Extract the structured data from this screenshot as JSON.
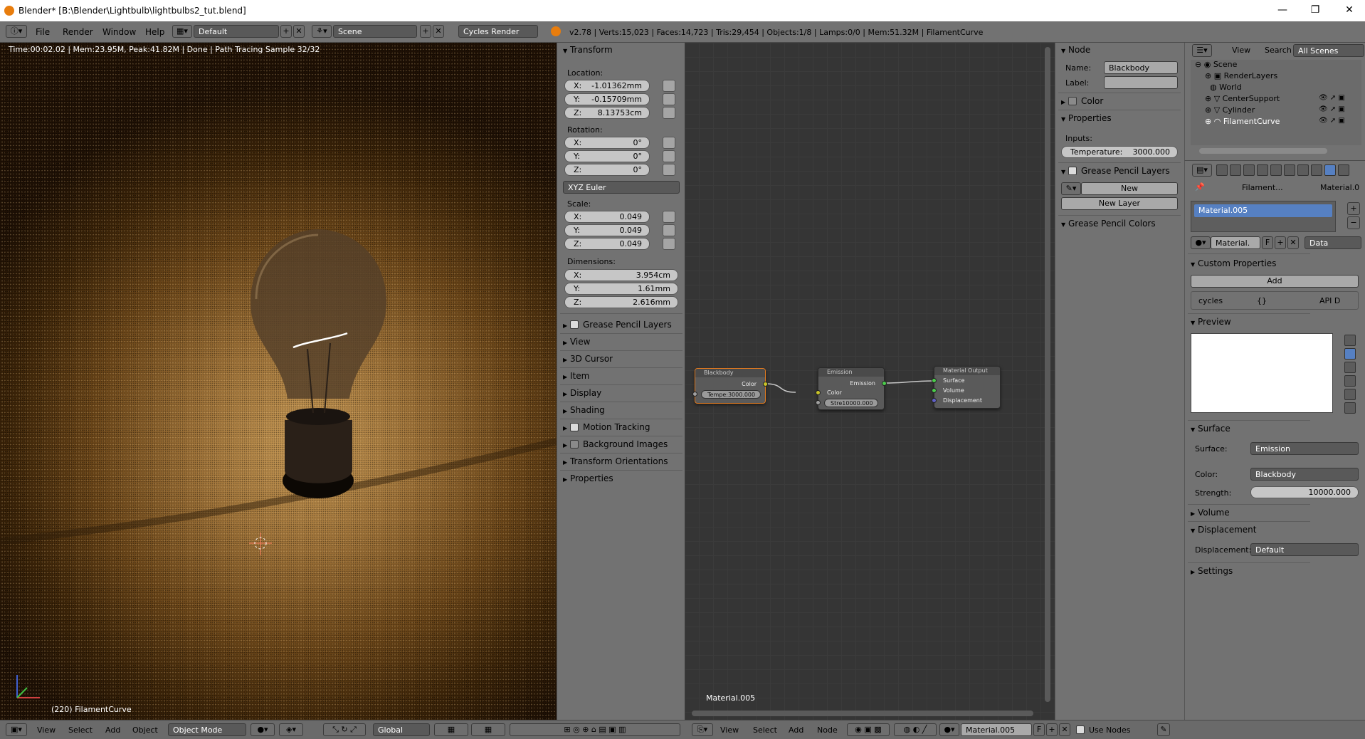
{
  "window": {
    "title": "Blender* [B:\\Blender\\Lightbulb\\lightbulbs2_tut.blend]",
    "min": "—",
    "max": "❐",
    "close": "✕"
  },
  "infobar": {
    "menus": [
      "File",
      "Render",
      "Window",
      "Help"
    ],
    "layout": "Default",
    "scene": "Scene",
    "engine": "Cycles Render",
    "stats": "v2.78 | Verts:15,023 | Faces:14,723 | Tris:29,454 | Objects:1/8 | Lamps:0/0 | Mem:51.32M | FilamentCurve"
  },
  "viewport": {
    "render_status": "Time:00:02.02 | Mem:23.95M, Peak:41.82M | Done | Path Tracing Sample 32/32",
    "object_label": "(220) FilamentCurve",
    "header": {
      "menus": [
        "View",
        "Select",
        "Add",
        "Object"
      ],
      "mode": "Object Mode",
      "orientation": "Global"
    }
  },
  "npanel": {
    "transform_title": "Transform",
    "location_label": "Location:",
    "location": [
      {
        "k": "X:",
        "v": "-1.01362mm"
      },
      {
        "k": "Y:",
        "v": "-0.15709mm"
      },
      {
        "k": "Z:",
        "v": "8.13753cm"
      }
    ],
    "rotation_label": "Rotation:",
    "rotation": [
      {
        "k": "X:",
        "v": "0°"
      },
      {
        "k": "Y:",
        "v": "0°"
      },
      {
        "k": "Z:",
        "v": "0°"
      }
    ],
    "rotation_mode": "XYZ Euler",
    "scale_label": "Scale:",
    "scale": [
      {
        "k": "X:",
        "v": "0.049"
      },
      {
        "k": "Y:",
        "v": "0.049"
      },
      {
        "k": "Z:",
        "v": "0.049"
      }
    ],
    "dimensions_label": "Dimensions:",
    "dimensions": [
      {
        "k": "X:",
        "v": "3.954cm"
      },
      {
        "k": "Y:",
        "v": "1.61mm"
      },
      {
        "k": "Z:",
        "v": "2.616mm"
      }
    ],
    "sections": [
      {
        "label": "Grease Pencil Layers",
        "check": true
      },
      {
        "label": "View",
        "check": false
      },
      {
        "label": "3D Cursor",
        "check": false
      },
      {
        "label": "Item",
        "check": false
      },
      {
        "label": "Display",
        "check": false
      },
      {
        "label": "Shading",
        "check": false
      },
      {
        "label": "Motion Tracking",
        "check": true
      },
      {
        "label": "Background Images",
        "check": true
      },
      {
        "label": "Transform Orientations",
        "check": false
      },
      {
        "label": "Properties",
        "check": false
      }
    ]
  },
  "nodeeditor": {
    "material_label": "Material.005",
    "nodes": {
      "blackbody": {
        "title": "Blackbody",
        "out": "Color",
        "field": "Tempe:3000.000"
      },
      "emission": {
        "title": "Emission",
        "out": "Emission",
        "in": "Color",
        "field": "Stre10000.000"
      },
      "output": {
        "title": "Material Output",
        "inputs": [
          "Surface",
          "Volume",
          "Displacement"
        ]
      }
    },
    "header": {
      "menus": [
        "View",
        "Select",
        "Add",
        "Node"
      ],
      "material": "Material.005",
      "f": "F",
      "use_nodes": "Use Nodes"
    }
  },
  "nodeprops": {
    "node_title": "Node",
    "name_label": "Name:",
    "name_value": "Blackbody",
    "label_label": "Label:",
    "color_title": "Color",
    "properties_title": "Properties",
    "inputs_label": "Inputs:",
    "temperature": "Temperature:",
    "temperature_value": "3000.000",
    "gp_layers_title": "Grease Pencil Layers",
    "new_button": "New",
    "new_layer_button": "New Layer",
    "gp_colors_title": "Grease Pencil Colors"
  },
  "outliner": {
    "menus": [
      "View",
      "Search"
    ],
    "filter": "All Scenes",
    "items": [
      "Scene",
      "RenderLayers",
      "World",
      "CenterSupport",
      "Cylinder",
      "FilamentCurve"
    ]
  },
  "properties": {
    "breadcrumb": [
      "Filament...",
      "Material.0"
    ],
    "slot": "Material.005",
    "mat_field": "Material.",
    "f": "F",
    "link": "Data",
    "custom_props": "Custom Properties",
    "add": "Add",
    "cycles": "cycles",
    "braces": "{}",
    "api": "API D",
    "preview": "Preview",
    "surface_title": "Surface",
    "surface_label": "Surface:",
    "surface_value": "Emission",
    "color_label": "Color:",
    "color_value": "Blackbody",
    "strength_label": "Strength:",
    "strength_value": "10000.000",
    "volume": "Volume",
    "displacement_title": "Displacement",
    "displacement_label": "Displacement:",
    "displacement_value": "Default",
    "settings": "Settings"
  },
  "colors": {
    "panel": "#727272",
    "header": "#6a6a6a",
    "selection": "#5680c2",
    "node_link": "#c8c8c8"
  }
}
